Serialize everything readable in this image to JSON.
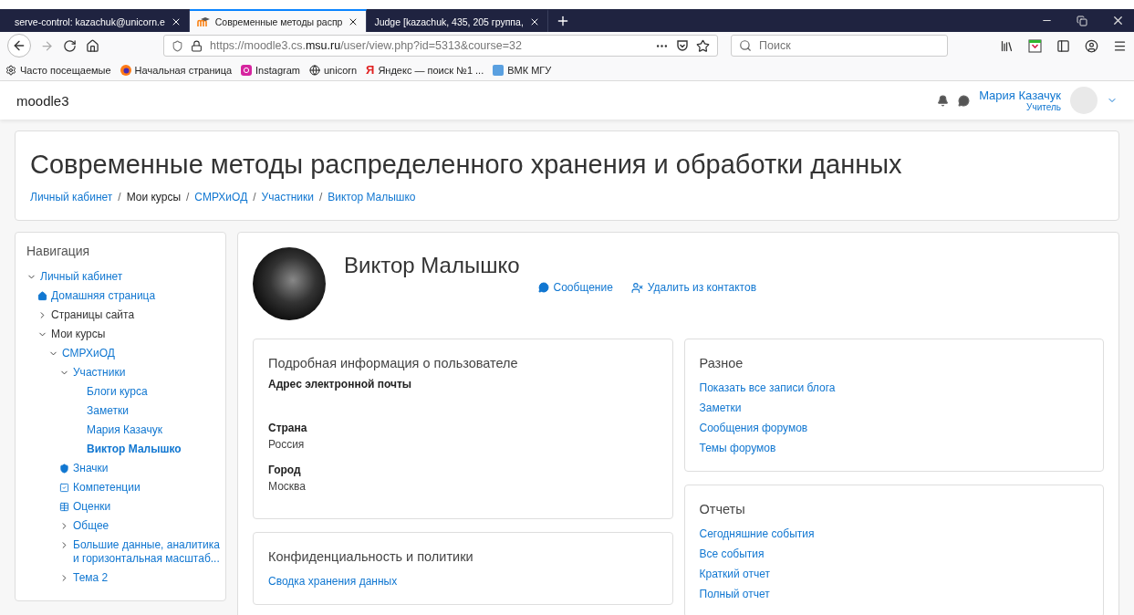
{
  "browser": {
    "tabs": [
      {
        "title": "serve-control: kazachuk@unicorn.e",
        "selected": false,
        "kind": "plain"
      },
      {
        "title": "Современные методы распр",
        "selected": true,
        "kind": "moodle"
      },
      {
        "title": "Judge [kazachuk, 435, 205 группа,",
        "selected": false,
        "kind": "plain"
      }
    ],
    "url": {
      "prefix": "https://moodle3.cs.",
      "domain": "msu.ru",
      "path": "/user/view.php?id=5313&course=32"
    },
    "search": {
      "placeholder": "Поиск"
    },
    "bookmarks": [
      {
        "label": "Часто посещаемые",
        "kind": "gear"
      },
      {
        "label": "Начальная страница",
        "kind": "firefox"
      },
      {
        "label": "Instagram",
        "kind": "instagram"
      },
      {
        "label": "unicorn",
        "kind": "globe"
      },
      {
        "label": "Яндекс — поиск №1 ...",
        "kind": "yandex",
        "glyph": "Я"
      },
      {
        "label": "ВМК МГУ",
        "kind": "vmk"
      }
    ]
  },
  "header": {
    "brand": "moodle3",
    "user": "Мария Казачук",
    "role": "Учитель"
  },
  "page": {
    "title": "Современные методы распределенного хранения и обработки данных",
    "separator": "/",
    "breadcrumbs": [
      {
        "label": "Личный кабинет",
        "link": true
      },
      {
        "label": "Мои курсы",
        "link": false
      },
      {
        "label": "СМРХиОД",
        "link": true
      },
      {
        "label": "Участники",
        "link": true
      },
      {
        "label": "Виктор Малышко",
        "link": true
      }
    ]
  },
  "navigation": {
    "title": "Навигация",
    "items": [
      {
        "label": "Личный кабинет",
        "kind": "branch",
        "expanded": true,
        "linked": true,
        "selected": false,
        "children": [
          {
            "label": "Домашняя страница",
            "kind": "home",
            "linked": true,
            "selected": false
          },
          {
            "label": "Страницы сайта",
            "kind": "branch",
            "expanded": false,
            "linked": false,
            "selected": false
          },
          {
            "label": "Мои курсы",
            "kind": "branch",
            "expanded": true,
            "linked": false,
            "selected": false,
            "children": [
              {
                "label": "СМРХиОД",
                "kind": "branch",
                "expanded": true,
                "linked": true,
                "selected": false,
                "children": [
                  {
                    "label": "Участники",
                    "kind": "branch",
                    "expanded": true,
                    "linked": true,
                    "selected": false,
                    "children": [
                      {
                        "label": "Блоги курса",
                        "kind": "leaf",
                        "linked": true,
                        "selected": false
                      },
                      {
                        "label": "Заметки",
                        "kind": "leaf",
                        "linked": true,
                        "selected": false
                      },
                      {
                        "label": "Мария Казачук",
                        "kind": "leaf",
                        "linked": true,
                        "selected": false
                      },
                      {
                        "label": "Виктор Малышко",
                        "kind": "leaf",
                        "linked": true,
                        "selected": true
                      }
                    ]
                  },
                  {
                    "label": "Значки",
                    "kind": "badge",
                    "linked": true,
                    "selected": false
                  },
                  {
                    "label": "Компетенции",
                    "kind": "check",
                    "linked": true,
                    "selected": false
                  },
                  {
                    "label": "Оценки",
                    "kind": "grid",
                    "linked": true,
                    "selected": false
                  },
                  {
                    "label": "Общее",
                    "kind": "branch",
                    "expanded": false,
                    "linked": true,
                    "selected": false
                  },
                  {
                    "label": "Большие данные, аналитика и горизонтальная масштаб...",
                    "kind": "branch",
                    "expanded": false,
                    "linked": true,
                    "selected": false
                  },
                  {
                    "label": "Тема 2",
                    "kind": "branch",
                    "expanded": false,
                    "linked": true,
                    "selected": false
                  }
                ]
              }
            ]
          }
        ]
      }
    ]
  },
  "profile": {
    "name": "Виктор Малышко",
    "actions": [
      {
        "label": "Сообщение",
        "kind": "message"
      },
      {
        "label": "Удалить из контактов",
        "kind": "remove-contact"
      }
    ]
  },
  "sections": {
    "left": [
      {
        "title": "Подробная информация о пользователе",
        "fields": [
          {
            "label": "Адрес электронной почты"
          },
          {
            "label": "Страна",
            "value": "Россия"
          },
          {
            "label": "Город",
            "value": "Москва"
          }
        ]
      },
      {
        "title": "Конфиденциальность и политики",
        "links": [
          "Сводка хранения данных"
        ]
      }
    ],
    "right": [
      {
        "title": "Разное",
        "links": [
          "Показать все записи блога",
          "Заметки",
          "Сообщения форумов",
          "Темы форумов"
        ]
      },
      {
        "title": "Отчеты",
        "links": [
          "Сегодняшние события",
          "Все события",
          "Краткий отчет",
          "Полный отчет"
        ]
      }
    ]
  }
}
